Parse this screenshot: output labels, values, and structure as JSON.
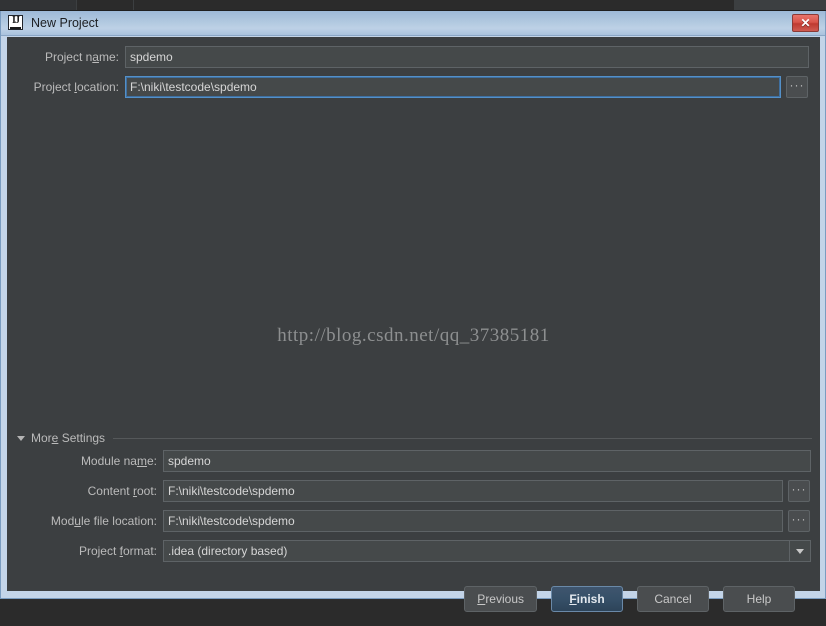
{
  "window": {
    "title": "New Project",
    "icon": "intellij-idea-icon",
    "close_label": "✕"
  },
  "fields": {
    "project_name": {
      "label_pre": "Project n",
      "label_mnemonic": "a",
      "label_post": "me:",
      "value": "spdemo"
    },
    "project_location": {
      "label_pre": "Project ",
      "label_mnemonic": "l",
      "label_post": "ocation:",
      "value": "F:\\niki\\testcode\\spdemo",
      "browse_label": "···"
    }
  },
  "watermark": {
    "text": "http://blog.csdn.net/qq_37385181"
  },
  "more_settings": {
    "label_pre": "Mor",
    "label_mnemonic": "e",
    "label_post": " Settings",
    "expanded": true,
    "rows": [
      {
        "label_pre": "Module na",
        "label_mnemonic": "m",
        "label_post": "e:",
        "value": "spdemo",
        "has_browse": false,
        "has_dropdown": false
      },
      {
        "label_pre": "Content ",
        "label_mnemonic": "r",
        "label_post": "oot:",
        "value": "F:\\niki\\testcode\\spdemo",
        "has_browse": true,
        "has_dropdown": false
      },
      {
        "label_pre": "Mod",
        "label_mnemonic": "u",
        "label_post": "le file location:",
        "value": "F:\\niki\\testcode\\spdemo",
        "has_browse": true,
        "has_dropdown": false
      },
      {
        "label_pre": "Project ",
        "label_mnemonic": "f",
        "label_post": "ormat:",
        "value": ".idea (directory based)",
        "has_browse": false,
        "has_dropdown": true
      }
    ],
    "browse_label": "···"
  },
  "buttons": [
    {
      "label_pre": "",
      "label_mnemonic": "P",
      "label_post": "revious",
      "default": false
    },
    {
      "label_pre": "",
      "label_mnemonic": "F",
      "label_post": "inish",
      "default": true
    },
    {
      "label_pre": "Cancel",
      "label_mnemonic": "",
      "label_post": "",
      "default": false
    },
    {
      "label_pre": "Help",
      "label_mnemonic": "",
      "label_post": "",
      "default": false
    }
  ],
  "colors": {
    "dialog_background": "#3c3f41",
    "window_frame": "#c3d4e8",
    "title_bar": "#aec6de",
    "field_background": "#45494a",
    "focus_border": "#5490c8",
    "default_button": "#365068",
    "close_button": "#d9554b",
    "text": "#bbbbbb"
  }
}
